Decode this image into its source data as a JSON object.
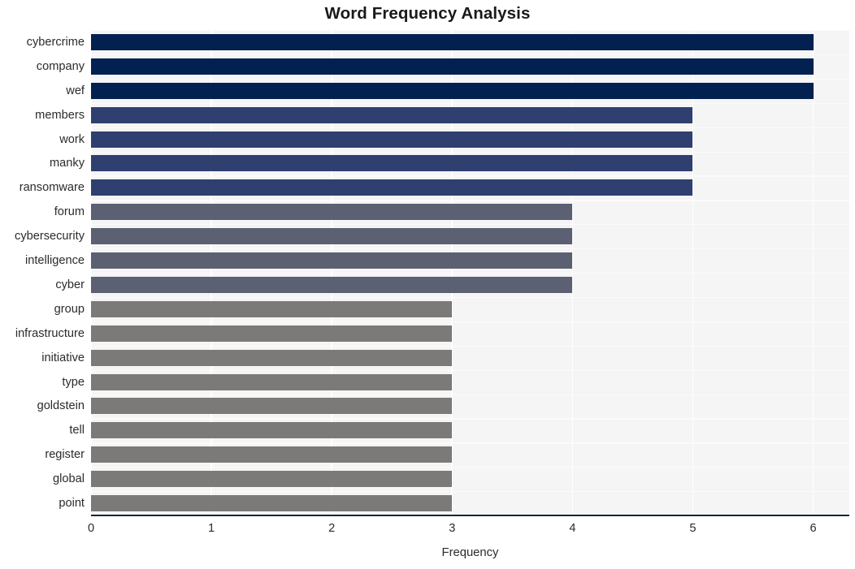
{
  "chart_data": {
    "type": "bar",
    "orientation": "horizontal",
    "title": "Word Frequency Analysis",
    "xlabel": "Frequency",
    "ylabel": "",
    "xlim": [
      0,
      6.3
    ],
    "xticks": [
      "0",
      "1",
      "2",
      "3",
      "4",
      "5",
      "6"
    ],
    "xtick_values": [
      0,
      1,
      2,
      3,
      4,
      5,
      6
    ],
    "grid": true,
    "legend": "none",
    "categories": [
      "cybercrime",
      "company",
      "wef",
      "members",
      "work",
      "manky",
      "ransomware",
      "forum",
      "cybersecurity",
      "intelligence",
      "cyber",
      "group",
      "infrastructure",
      "initiative",
      "type",
      "goldstein",
      "tell",
      "register",
      "global",
      "point"
    ],
    "values": [
      6,
      6,
      6,
      5,
      5,
      5,
      5,
      4,
      4,
      4,
      4,
      3,
      3,
      3,
      3,
      3,
      3,
      3,
      3,
      3
    ],
    "bar_colors": [
      "#022050",
      "#022050",
      "#022050",
      "#2f3f70",
      "#2f3f70",
      "#2f3f70",
      "#2f3f70",
      "#5b6072",
      "#5b6072",
      "#5b6072",
      "#5b6072",
      "#7b7a78",
      "#7b7a78",
      "#7b7a78",
      "#7b7a78",
      "#7b7a78",
      "#7b7a78",
      "#7b7a78",
      "#7b7a78",
      "#7b7a78"
    ]
  },
  "style": {
    "plot_background": "#f5f5f6",
    "figure_background": "#ffffff",
    "gridline_color": "#ffffff",
    "axis_line_color": "#17243f",
    "text_color": "#2b2b2b",
    "title_color": "#1a1a1a"
  }
}
